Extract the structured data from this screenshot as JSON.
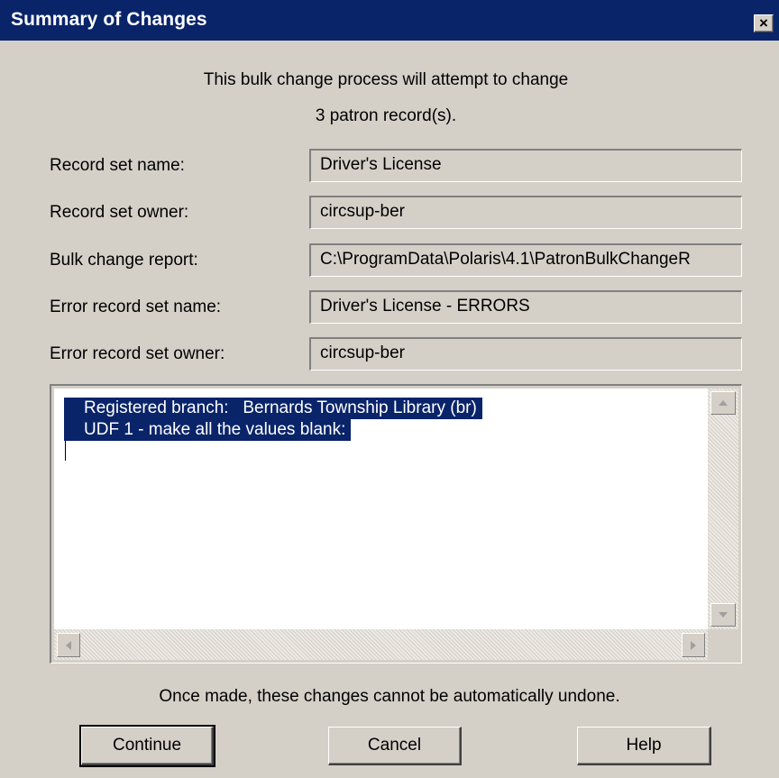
{
  "window": {
    "title": "Summary of Changes",
    "close_glyph": "×"
  },
  "intro": {
    "line1": "This bulk change process will attempt to change",
    "line2": "3   patron record(s)."
  },
  "fields": [
    {
      "label": "Record set name:",
      "value": "Driver's License"
    },
    {
      "label": "Record set owner:",
      "value": "circsup-ber"
    },
    {
      "label": "Bulk change report:",
      "value": "C:\\ProgramData\\Polaris\\4.1\\PatronBulkChangeR"
    },
    {
      "label": "Error record set name:",
      "value": "Driver's License - ERRORS"
    },
    {
      "label": "Error record set owner:",
      "value": "circsup-ber"
    }
  ],
  "changes_list": [
    "Registered branch:   Bernards Township Library (br)",
    "UDF 1 - make all the values blank:"
  ],
  "footer_note": "Once made, these changes cannot be automatically undone.",
  "buttons": {
    "continue": "Continue",
    "cancel": "Cancel",
    "help": "Help"
  },
  "colors": {
    "title_bar": "#0a246a",
    "dialog_bg": "#d4d0c8",
    "selection": "#0a246a"
  }
}
